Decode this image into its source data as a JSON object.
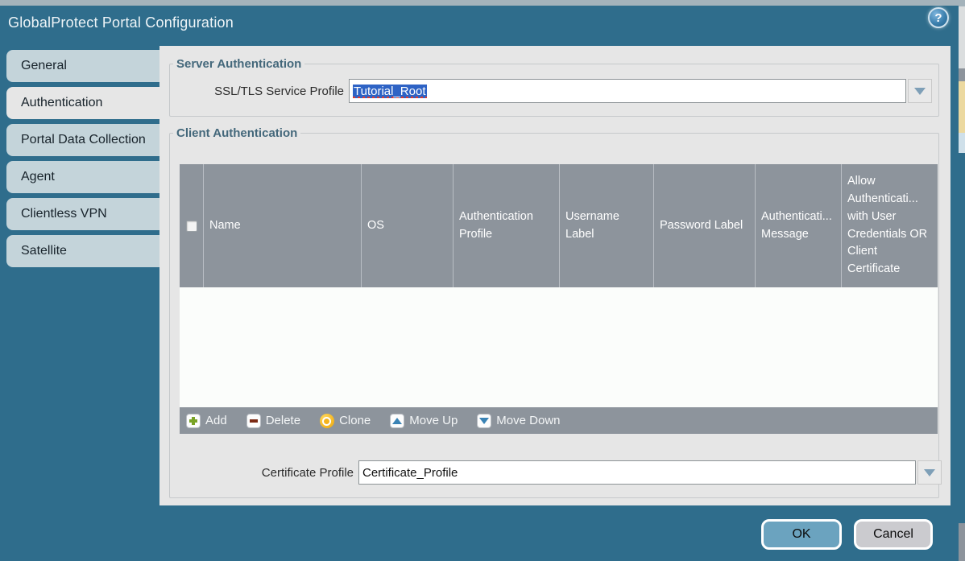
{
  "dialog": {
    "title": "GlobalProtect Portal Configuration",
    "help_icon_glyph": "?"
  },
  "sidebar": {
    "items": [
      {
        "label": "General",
        "selected": false
      },
      {
        "label": "Authentication",
        "selected": true
      },
      {
        "label": "Portal Data Collection",
        "selected": false
      },
      {
        "label": "Agent",
        "selected": false
      },
      {
        "label": "Clientless VPN",
        "selected": false
      },
      {
        "label": "Satellite",
        "selected": false
      }
    ]
  },
  "server_authentication": {
    "legend": "Server Authentication",
    "ssl_tls_label": "SSL/TLS Service Profile",
    "ssl_tls_value": "Tutorial_Root",
    "ssl_tls_value_is_selected": true
  },
  "client_authentication": {
    "legend": "Client Authentication",
    "table": {
      "columns": [
        "Name",
        "OS",
        "Authentication Profile",
        "Username Label",
        "Password Label",
        "Authenticati... Message",
        "Allow Authenticati... with User Credentials OR Client Certificate"
      ],
      "rows": []
    },
    "toolbar": [
      {
        "label": "Add",
        "icon": "add-icon",
        "icon_class": "ic-plus"
      },
      {
        "label": "Delete",
        "icon": "delete-icon",
        "icon_class": "ic-minus"
      },
      {
        "label": "Clone",
        "icon": "clone-icon",
        "icon_class": "ic-clone"
      },
      {
        "label": "Move Up",
        "icon": "move-up-icon",
        "icon_class": "ic-up"
      },
      {
        "label": "Move Down",
        "icon": "move-down-icon",
        "icon_class": "ic-down"
      }
    ],
    "certificate_profile_label": "Certificate Profile",
    "certificate_profile_value": "Certificate_Profile"
  },
  "footer": {
    "ok_label": "OK",
    "cancel_label": "Cancel"
  },
  "colors": {
    "titlebar_teal": "#2f6d8c",
    "tab_inactive": "#c4d4da",
    "panel_gray": "#e6e6e6",
    "table_header_gray": "#8d949c",
    "selection_blue": "#2e63c5",
    "ok_button_blue": "#6ba3bf",
    "cancel_button_gray": "#cbcbcf"
  }
}
